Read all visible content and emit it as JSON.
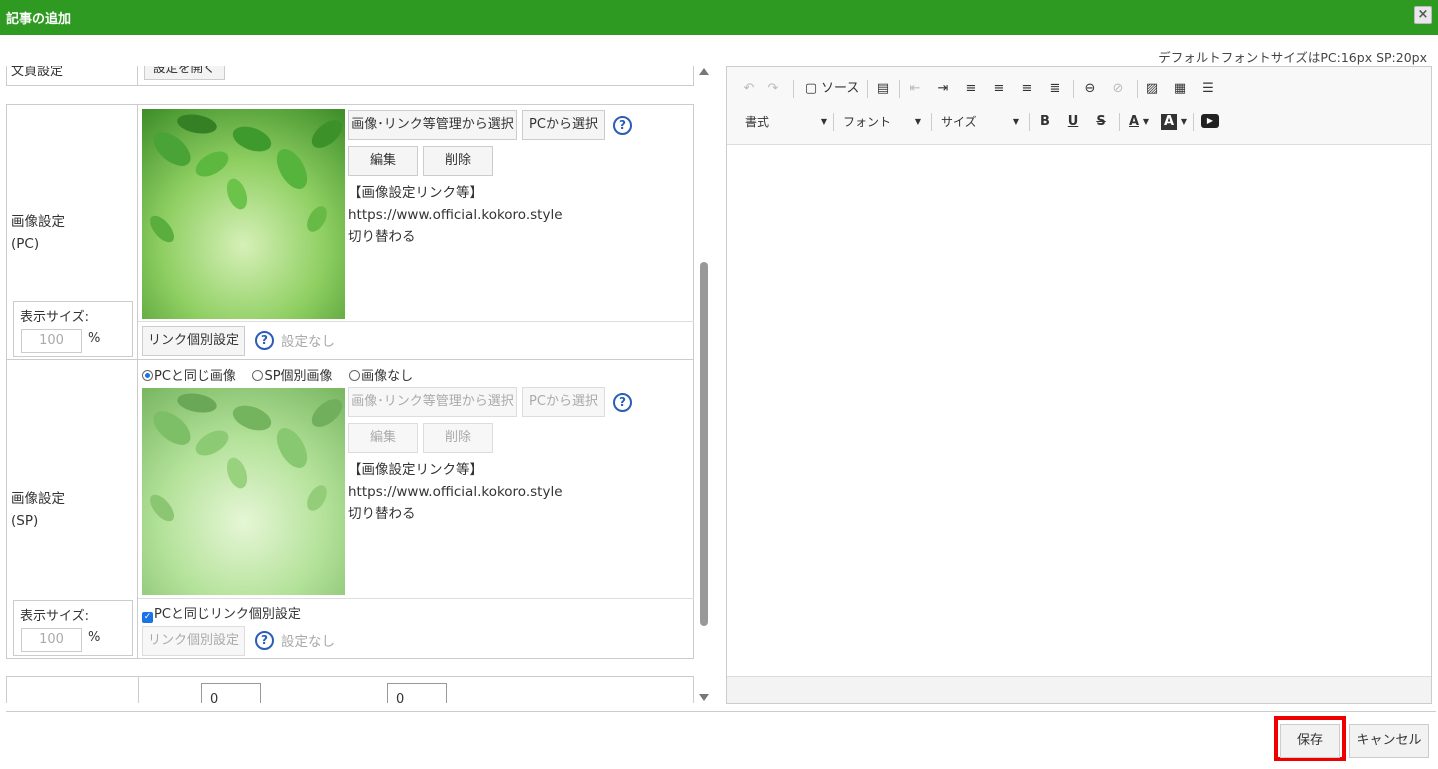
{
  "dialog": {
    "title": "記事の追加",
    "close_icon": "close-icon"
  },
  "font_note": "デフォルトフォントサイズはPC:16px SP:20px",
  "stub_row": {
    "label": "文頁設定",
    "button": "設定を開く"
  },
  "pc": {
    "label_line1": "画像設定",
    "label_line2": "(PC)",
    "size_label": "表示サイズ:",
    "size_value": "100",
    "size_unit": "%",
    "btn_manage": "画像･リンク等管理から選択",
    "btn_pc": "PCから選択",
    "btn_edit": "編集",
    "btn_delete": "削除",
    "info_title": "【画像設定リンク等】",
    "info_url": "https://www.official.kokoro.style",
    "info_note": "切り替わる",
    "btn_link": "リンク個別設定",
    "link_status": "設定なし"
  },
  "sp": {
    "label_line1": "画像設定",
    "label_line2": "(SP)",
    "radio_same": "PCと同じ画像",
    "radio_individual": "SP個別画像",
    "radio_none": "画像なし",
    "size_label": "表示サイズ:",
    "size_value": "100",
    "size_unit": "%",
    "btn_manage": "画像･リンク等管理から選択",
    "btn_pc": "PCから選択",
    "btn_edit": "編集",
    "btn_delete": "削除",
    "info_title": "【画像設定リンク等】",
    "info_url": "https://www.official.kokoro.style",
    "info_note": "切り替わる",
    "check_same_link": "PCと同じリンク個別設定",
    "btn_link": "リンク個別設定",
    "link_status": "設定なし"
  },
  "bottom_row": {
    "value1": "0",
    "value2": "0"
  },
  "editor": {
    "source_label": "ソース",
    "combo_format": "書式",
    "combo_font": "フォント",
    "combo_size": "サイズ",
    "bold": "B",
    "underline": "U",
    "strike": "S",
    "text_color": "A",
    "bg_color": "A"
  },
  "footer": {
    "save": "保存",
    "cancel": "キャンセル"
  },
  "colors": {
    "title_bar": "#2e9a22",
    "highlight": "#ee0000",
    "help": "#2a5db8"
  }
}
